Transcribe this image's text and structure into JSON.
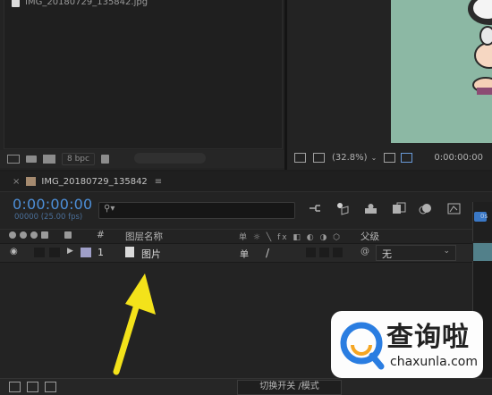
{
  "project": {
    "item_name": "IMG_20180729_135842.jpg",
    "bpc": "8 bpc"
  },
  "viewer": {
    "zoom": "(32.8%)",
    "timecode": "0:00:00:00"
  },
  "timeline": {
    "tab_close": "×",
    "tab_title": "IMG_20180729_135842",
    "tab_menu": "≡",
    "comp_color": "#a58a6f",
    "timecode": "0:00:00:00",
    "fps": "00000 (25.00 fps)",
    "search_icon": "search-icon",
    "ruler_label": "0s"
  },
  "layer_header": {
    "number": "#",
    "layer_name": "图层名称",
    "switch_icons": "单 ☼ ╲ fx ◧ ◐ ◑ ⬡",
    "parent": "父级"
  },
  "layers": [
    {
      "number": "1",
      "name": "图片",
      "label_color": "#9f9fc8",
      "switch_a": "单",
      "switch_b": "/",
      "parent_icon": "@",
      "parent_value": "无"
    }
  ],
  "bottom_bar": {
    "toggle_modes": "切换开关 /模式"
  },
  "watermark": {
    "title": "查询啦",
    "url": "chaxunla.com"
  }
}
